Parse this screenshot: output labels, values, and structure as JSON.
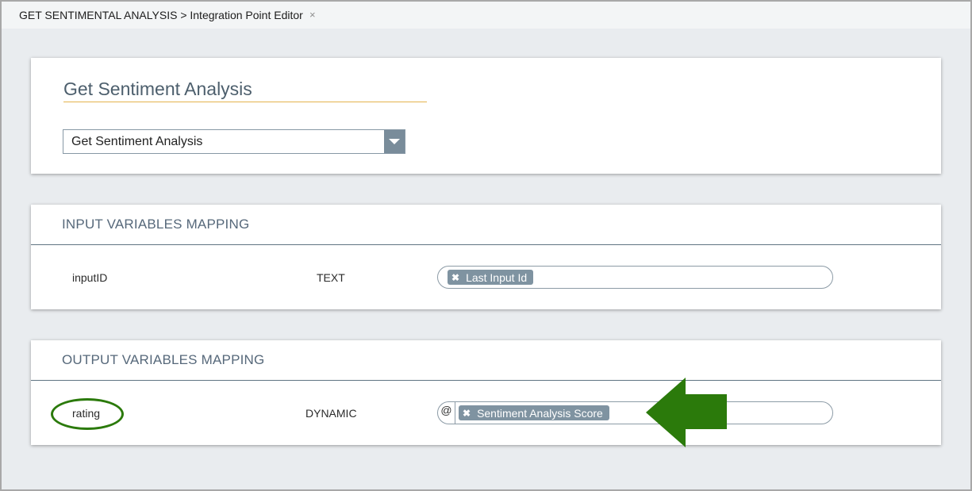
{
  "tab": {
    "title": "GET SENTIMENTAL ANALYSIS > Integration Point Editor",
    "close": "×"
  },
  "editor": {
    "name": "Get Sentiment Analysis",
    "integration_select": {
      "value": "Get Sentiment Analysis"
    }
  },
  "input_mapping": {
    "header": "INPUT VARIABLES MAPPING",
    "rows": [
      {
        "name": "inputID",
        "type": "TEXT",
        "chip": "Last Input Id"
      }
    ]
  },
  "output_mapping": {
    "header": "OUTPUT VARIABLES MAPPING",
    "rows": [
      {
        "name": "rating",
        "type": "DYNAMIC",
        "prefix": "@",
        "chip": "Sentiment Analysis Score"
      }
    ]
  },
  "chip_remove_glyph": "✖",
  "colors": {
    "accent_underline": "#e3b34d",
    "chip_bg": "#7f93a1",
    "select_button": "#798c9a",
    "annotation_green": "#2b7a0b"
  },
  "annotations": [
    "green-oval-highlight",
    "green-arrow-pointer"
  ]
}
